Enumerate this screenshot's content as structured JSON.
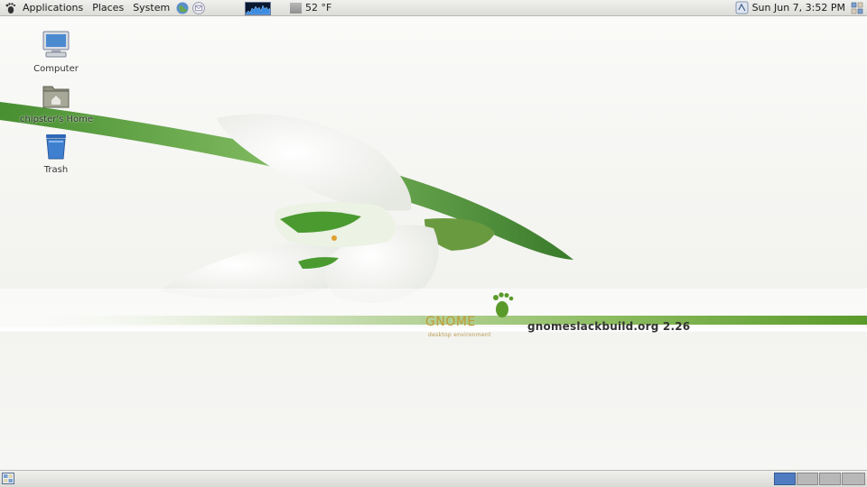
{
  "top_panel": {
    "menu": [
      "Applications",
      "Places",
      "System"
    ],
    "launchers": [
      "web-browser-icon",
      "email-client-icon"
    ],
    "system_monitor": "cpu-load-graph",
    "weather": {
      "temperature": "52 °F"
    },
    "clock": "Sun Jun  7,  3:52 PM"
  },
  "desktop": {
    "icons": [
      {
        "label": "Computer",
        "icon": "computer-icon"
      },
      {
        "label": "chipster's Home",
        "icon": "home-folder-icon"
      },
      {
        "label": "Trash",
        "icon": "trash-icon"
      }
    ]
  },
  "wallpaper": {
    "brand": "GNOME",
    "brand_sub": "desktop environment",
    "site": "gnomeslackbuild.org 2.26",
    "accent_color": "#5a9a2a",
    "brand_color": "#c09a3a"
  },
  "bottom_panel": {
    "workspaces": [
      {
        "active": true
      },
      {
        "active": false
      },
      {
        "active": false
      },
      {
        "active": false
      }
    ],
    "active_color": "#4f7cc0"
  }
}
